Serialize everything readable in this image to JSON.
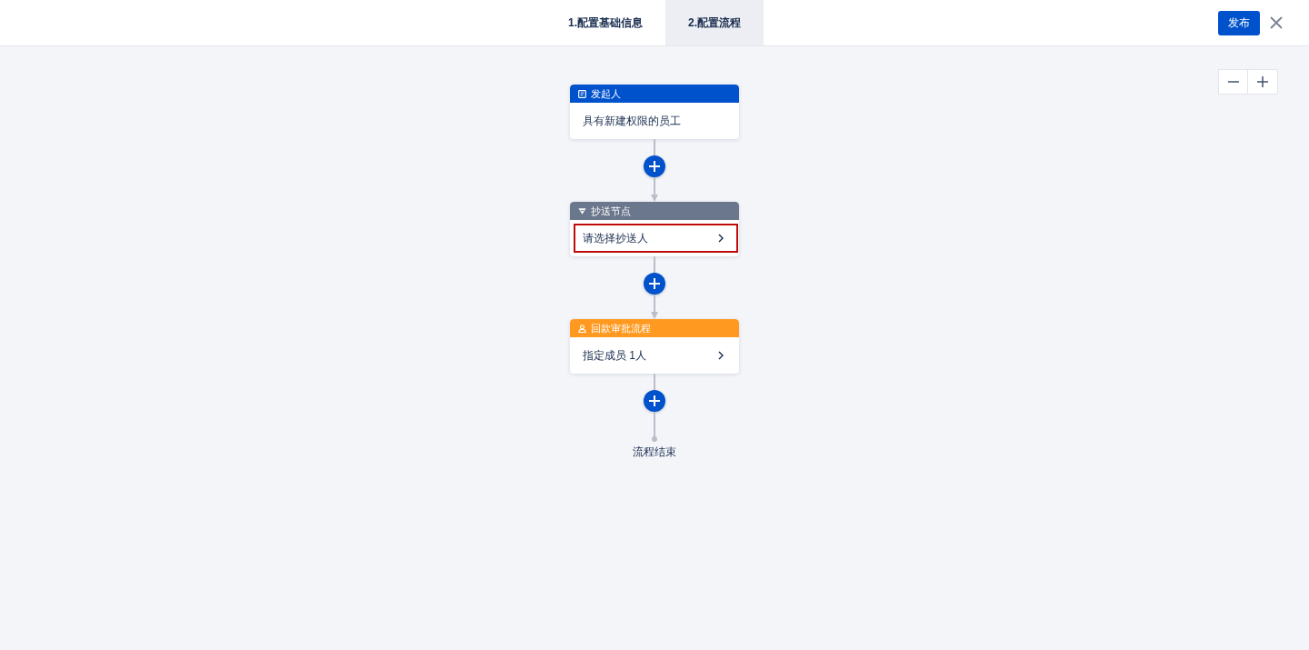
{
  "header": {
    "tabs": [
      {
        "label": "1.配置基础信息",
        "selected": false
      },
      {
        "label": "2.配置流程",
        "selected": true
      }
    ],
    "publish_button": "发布"
  },
  "flow": {
    "nodes": [
      {
        "kind": "initiator",
        "title": "发起人",
        "color": "#0052cc",
        "content": "具有新建权限的员工",
        "error": false
      },
      {
        "kind": "cc",
        "title": "抄送节点",
        "color": "#6b778c",
        "content": "请选择抄送人",
        "error": true
      },
      {
        "kind": "approver",
        "title": "回款审批流程",
        "color": "#ff991f",
        "content": "指定成员 1人",
        "error": false
      }
    ],
    "end_label": "流程结束"
  }
}
